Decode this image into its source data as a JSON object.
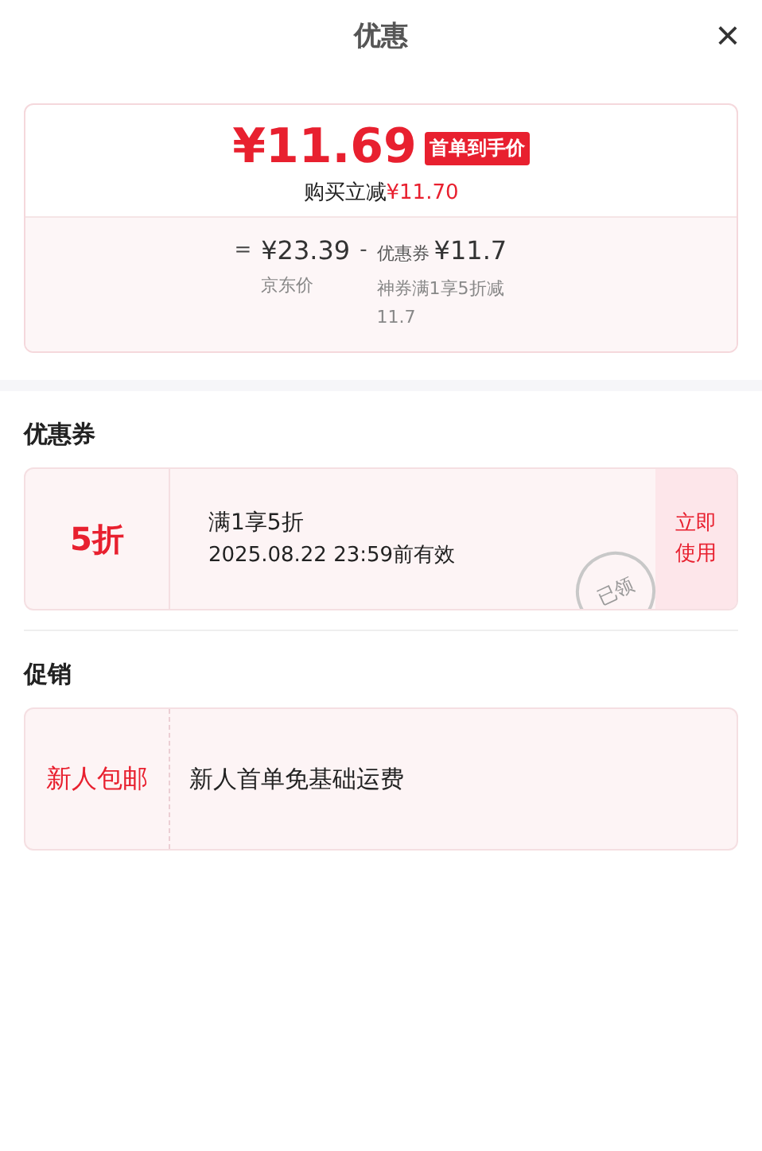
{
  "header": {
    "title": "优惠",
    "close": "×"
  },
  "summary": {
    "price": "¥11.69",
    "price_badge": "首单到手价",
    "saving_label": "购买立减",
    "saving_value": "¥11.70",
    "formula": [
      {
        "kind": "op",
        "text": "="
      },
      {
        "kind": "term",
        "amount": "¥23.39",
        "caption": "京东价"
      },
      {
        "kind": "op",
        "text": "-"
      },
      {
        "kind": "term",
        "prefix": "优惠券",
        "amount": "¥11.7",
        "caption": "神券满1享5折减11.7"
      }
    ]
  },
  "coupons": {
    "title": "优惠券",
    "items": [
      {
        "value": "5折",
        "condition": "满1享5折",
        "validity": "2025.08.22 23:59前有效",
        "stamp": "已领",
        "action": "立即使用"
      }
    ]
  },
  "promotions": {
    "title": "促销",
    "items": [
      {
        "tag": "新人包邮",
        "text": "新人首单免基础运费"
      }
    ]
  }
}
